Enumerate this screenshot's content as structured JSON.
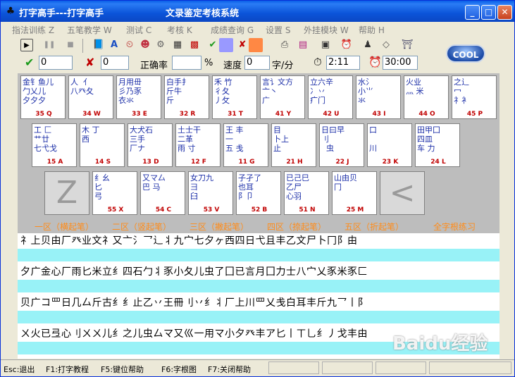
{
  "titlebar": {
    "app_title": "打字高手---打字高手",
    "window_title": "文录鉴定考核系统",
    "min": "_",
    "max": "□",
    "close": "✕"
  },
  "menu": [
    "指法训练 Z",
    "五笔教学 W",
    "测试 C",
    "考核 K",
    "成绩查询 G",
    "设置 S",
    "外挂模块 W",
    "帮助 H"
  ],
  "toolbar": {
    "correct_value": "0",
    "wrong_value": "0",
    "accuracy_label": "正确率",
    "accuracy_value": "",
    "percent": "%",
    "speed_label": "速度",
    "speed_value": "0",
    "speed_unit": "字/分",
    "elapsed": "2:11",
    "limit": "30:00",
    "cool": "COOL"
  },
  "keys_row1": [
    {
      "rad": "金钅鱼儿\n勹乂儿\n夕夕夕",
      "code": "35 Q"
    },
    {
      "rad": "人  亻\n八癶夂",
      "code": "34 W"
    },
    {
      "rad": "月用毌\n彡乃豕\n衣氺",
      "code": "33 E"
    },
    {
      "rad": "白手扌\n斤牛\n斤  ",
      "code": "32 R"
    },
    {
      "rad": "禾 竹\n彳夂\n丿攵",
      "code": "31 T"
    },
    {
      "rad": "言讠文方\n亠丶\n广",
      "code": "41 Y"
    },
    {
      "rad": "立六辛\n冫丷\n疒门",
      "code": "42 U"
    },
    {
      "rad": "水氵\n小⺌\n氺",
      "code": "43 I"
    },
    {
      "rad": "火业\n灬 米",
      "code": "44 O"
    },
    {
      "rad": "之辶\n冖\n礻衤",
      "code": "45 P"
    }
  ],
  "keys_row2": [
    {
      "rad": "工 匚\n艹廿\n七弋戈",
      "code": "15 A"
    },
    {
      "rad": "木 丁\n西",
      "code": "14 S"
    },
    {
      "rad": "大犬石\n三手\n厂ナ",
      "code": "13 D"
    },
    {
      "rad": "土士干\n二革\n雨 寸",
      "code": "12 F"
    },
    {
      "rad": "王 丰\n一\n五 戋",
      "code": "11 G"
    },
    {
      "rad": "目 \n卜上\n止 ",
      "code": "21 H"
    },
    {
      "rad": "日曰早\n刂\n  虫",
      "code": "22 J"
    },
    {
      "rad": "口\n  \n川 ",
      "code": "23 K"
    },
    {
      "rad": "田甲囗\n四皿\n车 力",
      "code": "24 L"
    }
  ],
  "keys_row3": [
    {
      "rad": "Z",
      "code": "",
      "big": true
    },
    {
      "rad": "纟幺\n匕\n弓  ",
      "code": "55 X"
    },
    {
      "rad": "又マ厶\n巴 马",
      "code": "54 C"
    },
    {
      "rad": "女刀九\n彐\n臼  ",
      "code": "53 V"
    },
    {
      "rad": "子孑了\n也耳\n阝卩",
      "code": "52 B"
    },
    {
      "rad": "已己巳\n乙尸\n心羽",
      "code": "51 N"
    },
    {
      "rad": "山由贝\n冂",
      "code": "25 M"
    },
    {
      "rad": "<\n,",
      "code": "",
      "big": true
    }
  ],
  "zones": [
    "一区（横起笔）",
    "二区（竖起笔）",
    "三区（撇起笔）",
    "四区（捺起笔）",
    "五区（折起笔）",
    "全字根练习"
  ],
  "practice_rows": [
    "礻上贝由厂癶业文礻又亠氵乛辶丬九宀七夕ヶ西四日弋且丰乙文尸卜冂阝由",
    "夕广金心厂雨匕米立纟四石勹丬豕小夂儿虫了囗已言月囗力士八宀乂豕米豕匚",
    "贝广コ罒日几厶斤古纟纟止乙丷王冊刂丷纟丬厂上川罒乂戋白耳丰斤九乛丨阝",
    "ㄨ火已弖心刂ㄨㄨ儿纟之儿虫厶マ又巛一用マ小夕癶丰ア匕丨ㄒ乚纟丿戈丰由"
  ],
  "status": [
    "Esc:退出",
    "F1:打字教程",
    "F5:键位帮助",
    "F6:字根图",
    "F7:关闭帮助"
  ],
  "watermark": "Baidu经验"
}
